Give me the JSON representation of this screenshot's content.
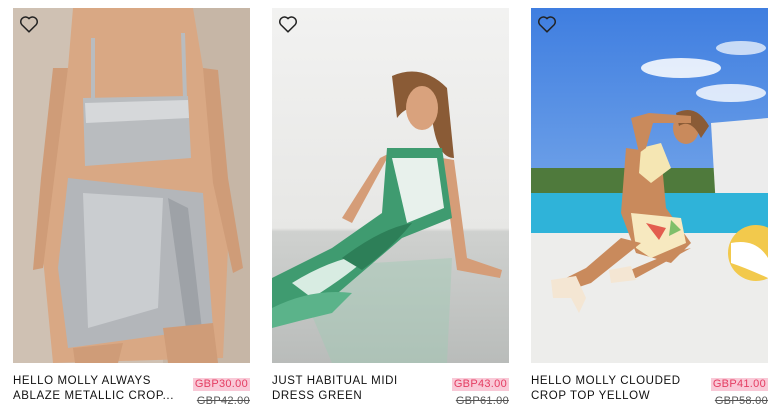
{
  "products": [
    {
      "name_line1": "HELLO MOLLY ALWAYS",
      "name_line2": "ABLAZE METALLIC CROP...",
      "sale_price": "GBP30.00",
      "original_price": "GBP42.00",
      "image": "woman in silver metallic crop top and wrap mini skirt"
    },
    {
      "name_line1": "JUST HABITUAL MIDI",
      "name_line2": "DRESS GREEN",
      "sale_price": "GBP43.00",
      "original_price": "GBP61.00",
      "image": "woman seated in green marble print midi dress"
    },
    {
      "name_line1": "HELLO MOLLY CLOUDED",
      "name_line2": "CROP TOP YELLOW",
      "sale_price": "GBP41.00",
      "original_price": "GBP58.00",
      "image": "woman by pool in yellow floral crop top and shorts"
    }
  ],
  "colors": {
    "sale_bg": "#f9c9d7",
    "sale_text": "#e43d62",
    "text": "#111111"
  },
  "icons": {
    "wishlist": "heart-outline-icon"
  }
}
